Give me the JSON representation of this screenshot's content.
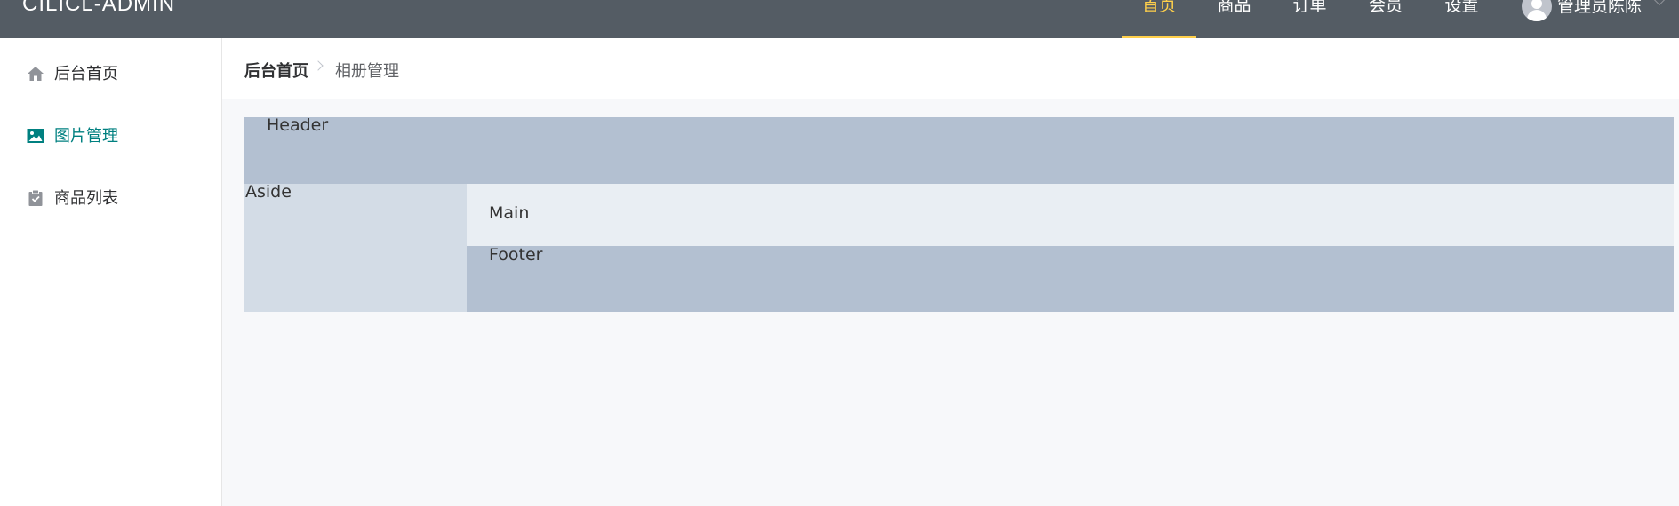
{
  "app": {
    "brand": "CILICL-ADMIN"
  },
  "topnav": {
    "items": [
      {
        "label": "首页",
        "active": true
      },
      {
        "label": "商品",
        "active": false
      },
      {
        "label": "订单",
        "active": false
      },
      {
        "label": "会员",
        "active": false
      },
      {
        "label": "设置",
        "active": false
      }
    ],
    "active_color": "#ffd04b",
    "background": "#545c64"
  },
  "user": {
    "name": "管理员陈陈",
    "avatar_icon": "user-avatar-icon",
    "dropdown_icon": "chevron-down-icon"
  },
  "sidebar": {
    "items": [
      {
        "label": "后台首页",
        "icon": "home-icon",
        "active": false
      },
      {
        "label": "图片管理",
        "icon": "image-icon",
        "active": true
      },
      {
        "label": "商品列表",
        "icon": "clipboard-icon",
        "active": false
      }
    ],
    "active_color": "#008080"
  },
  "breadcrumb": {
    "home": "后台首页",
    "current": "相册管理"
  },
  "layout_demo": {
    "header": "Header",
    "aside": "Aside",
    "main": "Main",
    "footer": "Footer",
    "colors": {
      "header": "#b3c0d1",
      "aside": "#d3dce6",
      "main": "#e9eef3",
      "footer": "#b3c0d1"
    }
  }
}
